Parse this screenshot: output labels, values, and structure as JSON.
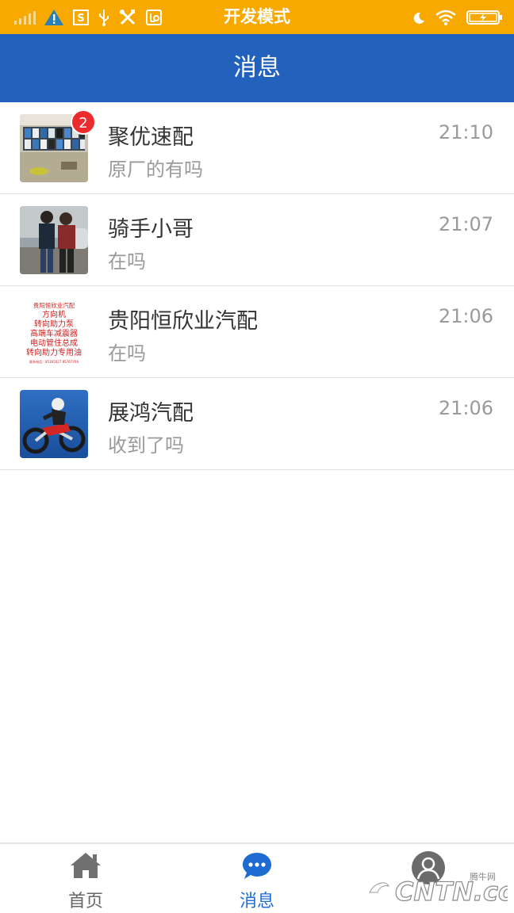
{
  "status_bar": {
    "title": "开发模式",
    "icons": [
      "signal-icon",
      "warning-icon",
      "s-box-icon",
      "usb-icon",
      "tools-icon",
      "settings-box-icon",
      "moon-icon",
      "wifi-icon",
      "battery-icon"
    ]
  },
  "header": {
    "title": "消息"
  },
  "conversations": [
    {
      "name": "聚优速配",
      "message": "原厂的有吗",
      "time": "21:10",
      "badge": "2",
      "avatar": "auto-parts-shelf-photo"
    },
    {
      "name": "骑手小哥",
      "message": "在吗",
      "time": "21:07",
      "avatar": "two-people-photo"
    },
    {
      "name": "贵阳恒欣业汽配",
      "message": "在吗",
      "time": "21:06",
      "avatar": "red-text-ad-image",
      "avatar_text": [
        "贵阳恒欣业汽配",
        "方向机",
        "转向助力泵",
        "高端车减震器",
        "电动管住总成",
        "转向助力专用油",
        "联系电话：85165027 85767706"
      ]
    },
    {
      "name": "展鸿汽配",
      "message": "收到了吗",
      "time": "21:06",
      "avatar": "motocross-photo"
    }
  ],
  "tabs": [
    {
      "label": "首页",
      "icon": "home-icon",
      "active": false
    },
    {
      "label": "消息",
      "icon": "chat-bubble-icon",
      "active": true
    },
    {
      "label": "",
      "icon": "person-icon",
      "active": false
    }
  ],
  "watermark": {
    "text": "CNTN.com",
    "small": "腾牛网"
  },
  "colors": {
    "status_bar": "#f7a900",
    "header": "#2262bd",
    "badge": "#ec2c2c",
    "active_tab": "#1e6bd1"
  }
}
